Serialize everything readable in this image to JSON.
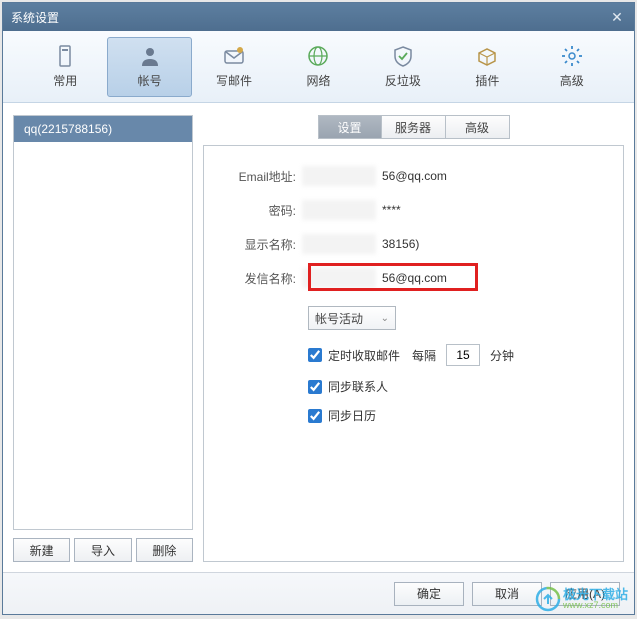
{
  "title": "系统设置",
  "toolbar": [
    {
      "id": "general",
      "label": "常用"
    },
    {
      "id": "account",
      "label": "帐号"
    },
    {
      "id": "compose",
      "label": "写邮件"
    },
    {
      "id": "network",
      "label": "网络"
    },
    {
      "id": "antispam",
      "label": "反垃圾"
    },
    {
      "id": "plugin",
      "label": "插件"
    },
    {
      "id": "advanced",
      "label": "高级"
    }
  ],
  "active_toolbar": "account",
  "account_list": {
    "items": [
      "qq(2215788156)"
    ]
  },
  "left_buttons": {
    "new": "新建",
    "import": "导入",
    "delete": "删除"
  },
  "tabs": {
    "settings": "设置",
    "server": "服务器",
    "advanced": "高级",
    "active": "settings"
  },
  "form": {
    "email_label": "Email地址:",
    "email_value_visible": "56@qq.com",
    "password_label": "密码:",
    "password_value_visible": "****",
    "display_label": "显示名称:",
    "display_value_visible": "38156)",
    "sender_label": "发信名称:",
    "sender_value_visible": "56@qq.com"
  },
  "dropdown": {
    "label": "帐号活动"
  },
  "checks": {
    "fetch": {
      "label": "定时收取邮件",
      "checked": true,
      "every": "每隔",
      "interval": "15",
      "unit": "分钟"
    },
    "contacts": {
      "label": "同步联系人",
      "checked": true
    },
    "calendar": {
      "label": "同步日历",
      "checked": true
    }
  },
  "footer": {
    "ok": "确定",
    "cancel": "取消",
    "apply": "应用(A)"
  },
  "watermark": {
    "name": "极光下载站",
    "url": "www.xz7.com"
  }
}
